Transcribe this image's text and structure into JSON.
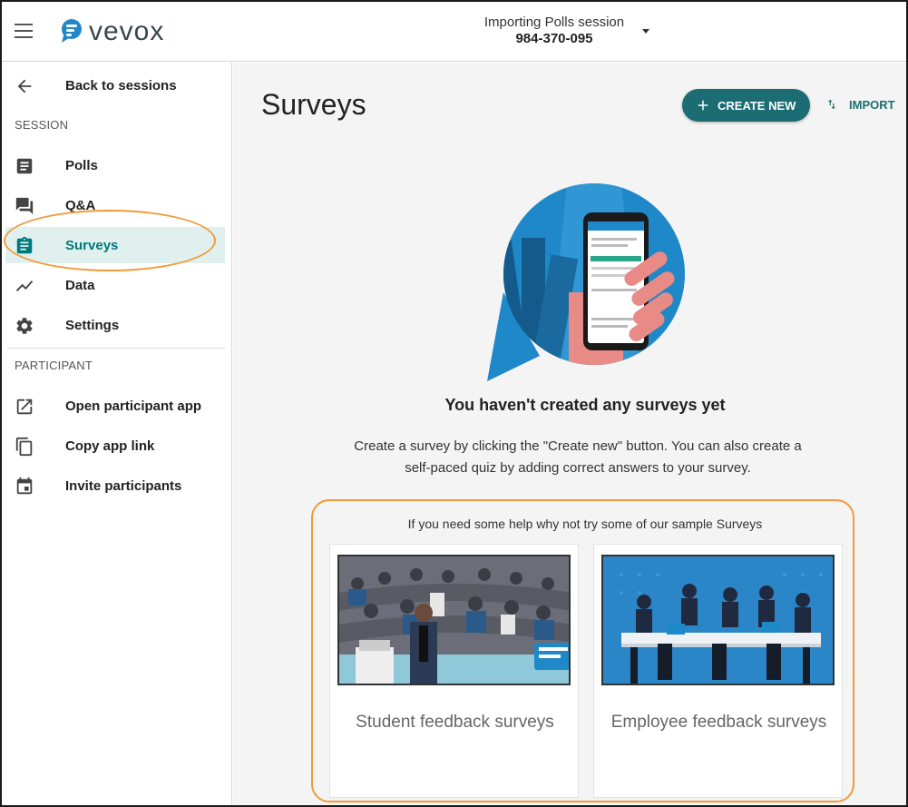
{
  "header": {
    "logo_text": "vevox",
    "session_name": "Importing Polls session",
    "session_code": "984-370-095"
  },
  "sidebar": {
    "back_label": "Back to sessions",
    "section_session": "SESSION",
    "items": [
      {
        "label": "Polls",
        "icon": "polls-icon"
      },
      {
        "label": "Q&A",
        "icon": "qa-icon"
      },
      {
        "label": "Surveys",
        "icon": "surveys-icon",
        "active": true
      },
      {
        "label": "Data",
        "icon": "data-icon"
      },
      {
        "label": "Settings",
        "icon": "gear-icon"
      }
    ],
    "section_participant": "PARTICIPANT",
    "participant_items": [
      {
        "label": "Open participant app",
        "icon": "open-external-icon"
      },
      {
        "label": "Copy app link",
        "icon": "copy-icon"
      },
      {
        "label": "Invite participants",
        "icon": "calendar-icon"
      }
    ]
  },
  "main": {
    "title": "Surveys",
    "create_label": "CREATE NEW",
    "import_label": "IMPORT",
    "empty_title": "You haven't created any surveys yet",
    "empty_desc": "Create a survey by clicking the \"Create new\" button. You can also create a self-paced quiz by adding correct answers to your survey.",
    "sample_heading": "If you need some help why not try some of our sample Surveys",
    "samples": [
      {
        "label": "Student feedback surveys"
      },
      {
        "label": "Employee feedback surveys"
      }
    ]
  },
  "colors": {
    "accent": "#1b6d73",
    "active_bg": "#e0f0ef",
    "highlight": "#f29a38",
    "hero_blue": "#1e88c9"
  }
}
